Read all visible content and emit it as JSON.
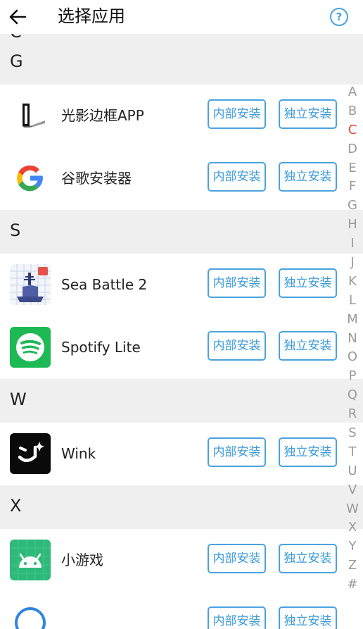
{
  "header": {
    "title": "选择应用",
    "help_label": "?"
  },
  "partial_section": "C",
  "sections": [
    {
      "letter": "G",
      "apps": [
        {
          "name": "光影边框APP",
          "icon": "photo-frame-app-icon"
        },
        {
          "name": "谷歌安装器",
          "icon": "google-g-icon"
        }
      ]
    },
    {
      "letter": "S",
      "apps": [
        {
          "name": "Sea Battle 2",
          "icon": "battleship-icon"
        },
        {
          "name": "Spotify Lite",
          "icon": "spotify-icon"
        }
      ]
    },
    {
      "letter": "W",
      "apps": [
        {
          "name": "Wink",
          "icon": "wink-face-icon"
        }
      ]
    },
    {
      "letter": "X",
      "apps": [
        {
          "name": "小游戏",
          "icon": "android-robot-icon"
        }
      ]
    }
  ],
  "buttons": {
    "internal": "内部安装",
    "standalone": "独立安装"
  },
  "index_letters": [
    "A",
    "B",
    "C",
    "D",
    "E",
    "F",
    "G",
    "H",
    "I",
    "J",
    "K",
    "L",
    "M",
    "N",
    "O",
    "P",
    "Q",
    "R",
    "S",
    "T",
    "U",
    "V",
    "W",
    "X",
    "Y",
    "Z",
    "#"
  ],
  "active_index": "C",
  "colors": {
    "accent": "#4aa3df",
    "active_index": "#e64a3b",
    "section_bg": "#efefef"
  }
}
